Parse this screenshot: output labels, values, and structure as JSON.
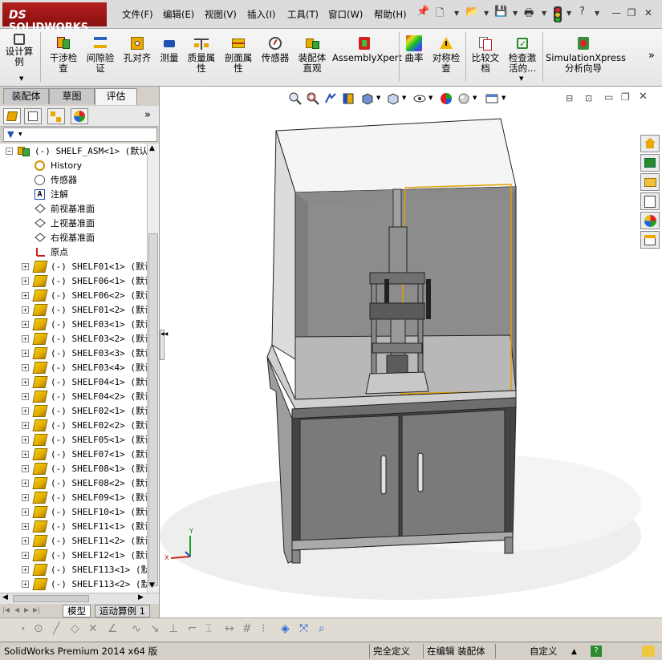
{
  "app": {
    "logo_prefix": "DS",
    "logo_text": "SOLIDWORKS"
  },
  "menu": [
    "文件(F)",
    "编辑(E)",
    "视图(V)",
    "插入(I)",
    "工具(T)",
    "窗口(W)",
    "帮助(H)"
  ],
  "ribbon": {
    "buttons": [
      {
        "label": "设计算\n例",
        "icon": "calculator-icon"
      },
      {
        "label": "干涉检\n查",
        "icon": "interference-check-icon"
      },
      {
        "label": "间隙验\n证",
        "icon": "clearance-icon"
      },
      {
        "label": "孔对齐",
        "icon": "hole-alignment-icon"
      },
      {
        "label": "测量",
        "icon": "measure-icon"
      },
      {
        "label": "质量属\n性",
        "icon": "mass-properties-icon"
      },
      {
        "label": "剖面属\n性",
        "icon": "section-properties-icon"
      },
      {
        "label": "传感器",
        "icon": "sensor-icon"
      },
      {
        "label": "装配体\n直观",
        "icon": "assembly-visualization-icon"
      },
      {
        "label": "AssemblyXpert",
        "icon": "assemblyxpert-icon"
      },
      {
        "label": "曲率",
        "icon": "curvature-icon"
      },
      {
        "label": "对称检\n查",
        "icon": "symmetry-check-icon"
      },
      {
        "label": "比较文\n档",
        "icon": "compare-documents-icon"
      },
      {
        "label": "检查激\n活的...",
        "icon": "check-active-icon"
      },
      {
        "label": "SimulationXpress\n分析向导",
        "icon": "simulationxpress-icon"
      }
    ]
  },
  "left_tabs": [
    "装配体",
    "草图",
    "评估"
  ],
  "tree": {
    "root": "(-) SHELF_ASM<1> (默认<",
    "items": [
      {
        "label": "History",
        "icon": "history-icon"
      },
      {
        "label": "传感器",
        "icon": "sensor-folder-icon"
      },
      {
        "label": "注解",
        "icon": "annotations-icon"
      },
      {
        "label": "前视基准面",
        "icon": "plane-icon"
      },
      {
        "label": "上视基准面",
        "icon": "plane-icon"
      },
      {
        "label": "右视基准面",
        "icon": "plane-icon"
      },
      {
        "label": "原点",
        "icon": "origin-icon"
      }
    ],
    "parts": [
      "(-) SHELF01<1> (默认",
      "(-) SHELF06<1> (默认",
      "(-) SHELF06<2> (默认",
      "(-) SHELF01<2> (默认",
      "(-) SHELF03<1> (默认",
      "(-) SHELF03<2> (默认",
      "(-) SHELF03<3> (默认",
      "(-) SHELF03<4> (默认",
      "(-) SHELF04<1> (默认",
      "(-) SHELF04<2> (默认",
      "(-) SHELF02<1> (默认",
      "(-) SHELF02<2> (默认",
      "(-) SHELF05<1> (默认",
      "(-) SHELF07<1> (默认",
      "(-) SHELF08<1> (默认",
      "(-) SHELF08<2> (默认",
      "(-) SHELF09<1> (默认",
      "(-) SHELF10<1> (默认",
      "(-) SHELF11<1> (默认",
      "(-) SHELF11<2> (默认",
      "(-) SHELF12<1> (默认",
      "(-) SHELF113<1> (默认",
      "(-) SHELF113<2> (默认"
    ]
  },
  "bottom_tabs": [
    "模型",
    "运动算例 1"
  ],
  "triad": {
    "x": "X",
    "y": "Y"
  },
  "status": {
    "version": "SolidWorks Premium 2014 x64 版",
    "definition": "完全定义",
    "editing": "在编辑 装配体",
    "units": "自定义",
    "help": "?"
  }
}
